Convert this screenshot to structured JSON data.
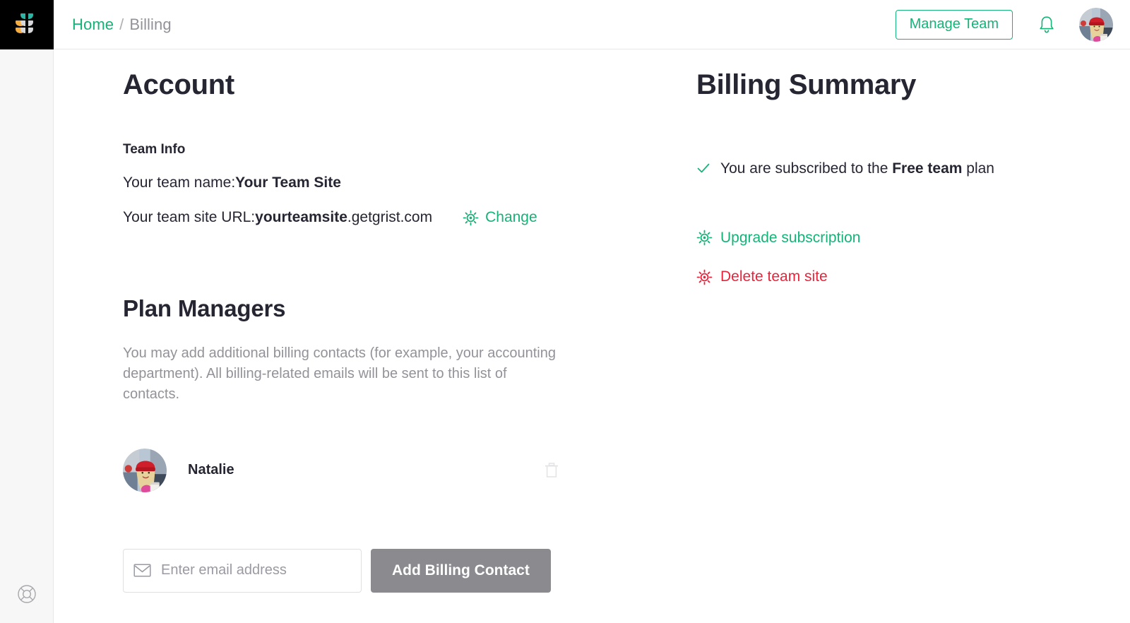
{
  "brand": {
    "accent_green": "#16b378",
    "danger_red": "#e8243c",
    "text_dark": "#262633",
    "text_muted": "#929299",
    "logo_teal": "#2cb4a4",
    "logo_orange": "#f5ad3f",
    "logo_gray": "#d6d7d9",
    "sidebar_bg": "#f7f7f7",
    "disabled_gray": "#8a8a8f"
  },
  "sidebar": {
    "logo_name": "grist-logo",
    "help_icon": "lifebuoy-help-icon"
  },
  "topbar": {
    "breadcrumb": {
      "home_label": "Home",
      "separator": "/",
      "current_label": "Billing"
    },
    "manage_team_label": "Manage Team",
    "notifications_icon": "bell-icon",
    "avatar_icon": "user-avatar-photo"
  },
  "account": {
    "title": "Account",
    "team_info_label": "Team Info",
    "team_name_prefix": "Your team name: ",
    "team_name_value": "Your Team Site",
    "team_url_prefix": "Your team site URL: ",
    "team_url_bold": "yourteamsite",
    "team_url_rest": ".getgrist.com",
    "change_label": "Change",
    "change_icon": "gear-icon"
  },
  "plan_managers": {
    "title": "Plan Managers",
    "description": "You may add additional billing contacts (for example, your accounting department). All billing-related emails will be sent to this list of contacts.",
    "contacts": [
      {
        "name": "Natalie",
        "avatar_icon": "contact-avatar-photo",
        "remove_icon": "trash-icon"
      }
    ],
    "email_input": {
      "placeholder": "Enter email address",
      "value": "",
      "icon": "envelope-icon"
    },
    "add_button_label": "Add Billing Contact",
    "add_button_enabled": false
  },
  "billing_summary": {
    "title": "Billing Summary",
    "subscription": {
      "check_icon": "check-icon",
      "prefix": "You are subscribed to the ",
      "plan_name": "Free team",
      "suffix": " plan"
    },
    "actions": [
      {
        "label": "Upgrade subscription",
        "icon": "gear-icon",
        "color": "#16b378"
      },
      {
        "label": "Delete team site",
        "icon": "gear-icon",
        "color": "#e8243c"
      }
    ]
  }
}
